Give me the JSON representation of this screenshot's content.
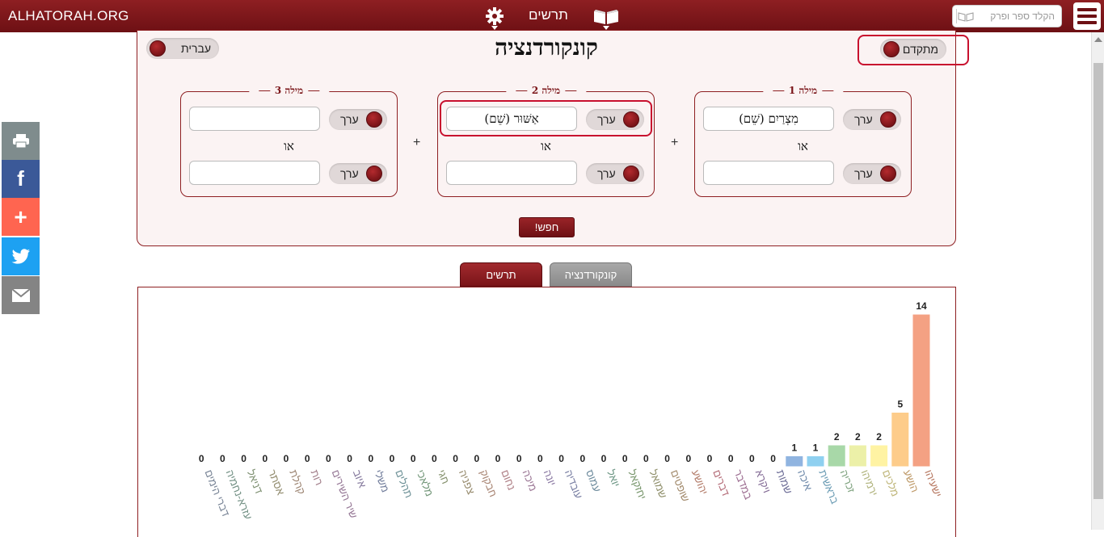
{
  "topbar": {
    "brand": "ALHATORAH.ORG",
    "nav_charts": "תרשים",
    "quick_search_placeholder": "הקלד ספר ופרק",
    "gear_icon": "gear-icon",
    "menu_icon": "hamburger-icon",
    "book_icon": "open-book-icon",
    "bar_color": "#7a1418"
  },
  "share": [
    {
      "name": "print",
      "glyph": "🖶",
      "color": "#7f8c8d"
    },
    {
      "name": "facebook",
      "glyph": "f",
      "color": "#3b5998"
    },
    {
      "name": "add",
      "glyph": "+",
      "color": "#ff6550"
    },
    {
      "name": "twitter",
      "glyph": "🐦",
      "color": "#1da1f2"
    },
    {
      "name": "email",
      "glyph": "✉",
      "color": "#848484"
    }
  ],
  "panel": {
    "title": "קונקורדנציה",
    "language_toggle": "עברית",
    "advanced_toggle": "מתקדם",
    "or_label": "או",
    "plus_label": "+",
    "edit_label": "ערך",
    "search_button": "חפש!",
    "words": [
      {
        "title": "מילה 1",
        "input1": "מִצְרַיִם (שֵׁם)",
        "input2": ""
      },
      {
        "title": "מילה 2",
        "input1": "אַשּׁוּר (שֵׁם)",
        "input2": ""
      },
      {
        "title": "מילה 3",
        "input1": "",
        "input2": ""
      }
    ]
  },
  "tabs": {
    "charts": "תרשים",
    "concordance": "קונקורדנציה"
  },
  "chart_data": {
    "type": "bar",
    "categories": [
      "ישעיהו",
      "הושע",
      "מלכים",
      "ירמיהו",
      "זכריה",
      "בראשית",
      "איכה",
      "שמות",
      "ויקרא",
      "במדבר",
      "דברים",
      "יהושע",
      "שופטים",
      "שמואל",
      "יחזקאל",
      "יואל",
      "עמוס",
      "עובדיה",
      "יונה",
      "מיכה",
      "נחום",
      "חבקוק",
      "צפניה",
      "חגי",
      "מלאכי",
      "תהלים",
      "משלי",
      "איוב",
      "שיר השירים",
      "רות",
      "קהלת",
      "אסתר",
      "דניאל",
      "עזרא-נחמיה",
      "דברי הימים"
    ],
    "values": [
      14,
      5,
      2,
      2,
      2,
      1,
      1,
      0,
      0,
      0,
      0,
      0,
      0,
      0,
      0,
      0,
      0,
      0,
      0,
      0,
      0,
      0,
      0,
      0,
      0,
      0,
      0,
      0,
      0,
      0,
      0,
      0,
      0,
      0,
      0
    ],
    "colors": [
      "#f4a183",
      "#fdcc8a",
      "#fff3a3",
      "#ecf0a8",
      "#a8d8a8",
      "#8fd0f0",
      "#90b4e0",
      "#9090c8",
      "#b090c8",
      "#d090c0",
      "#f090a0",
      "#f0a890",
      "#d8b890",
      "#c0c090",
      "#a0c890",
      "#90c8b0",
      "#90b8d0",
      "#a0a8d8",
      "#b8a0d8",
      "#d0a0c8",
      "#e8a8b0",
      "#e0b098",
      "#c8b890",
      "#b0c090",
      "#98c8a0",
      "#90c0c8",
      "#98a8d0",
      "#b0a0d0",
      "#c8a0c8",
      "#d8a8b8",
      "#d0b098",
      "#c0b890",
      "#a8c098",
      "#98c0b0",
      "#a0b0c8"
    ],
    "ylim": [
      0,
      14
    ]
  }
}
